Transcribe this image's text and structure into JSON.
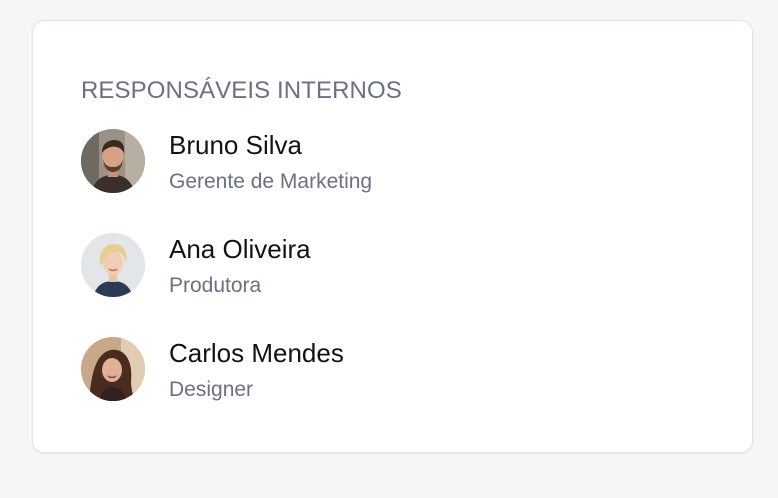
{
  "section": {
    "title": "RESPONSÁVEIS INTERNOS"
  },
  "people": [
    {
      "name": "Bruno Silva",
      "role": "Gerente de Marketing",
      "avatar_icon": "avatar-photo"
    },
    {
      "name": "Ana Oliveira",
      "role": "Produtora",
      "avatar_icon": "avatar-photo"
    },
    {
      "name": "Carlos Mendes",
      "role": "Designer",
      "avatar_icon": "avatar-photo"
    }
  ]
}
